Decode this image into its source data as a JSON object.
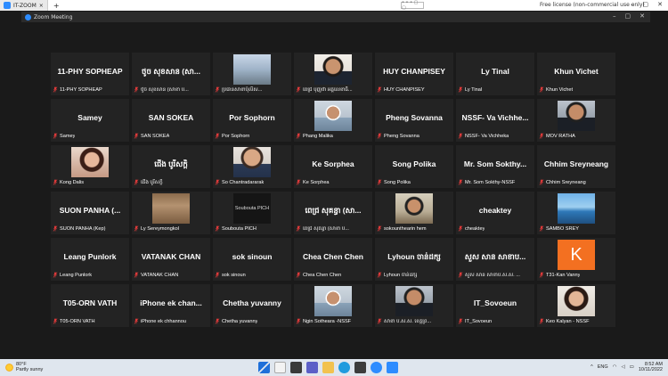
{
  "browser": {
    "tab_title": "IT-ZOOM",
    "new_tab_label": "+",
    "license_text": "Free license (non-commercial use only)",
    "center_indicator": "• • • ▢ ▢"
  },
  "zoom": {
    "title": "Zoom Meeting"
  },
  "participants": [
    {
      "display": "11-PHY SOPHEAP",
      "name": "11-PHY SOPHEAP",
      "video": false
    },
    {
      "display": "ថូច សុខសាន (សា...",
      "name": "ថូច សុខសាន (សាខា ប...",
      "video": false
    },
    {
      "display": "",
      "name": "ប្រធានសាខាប៉ុលិស...",
      "video": true,
      "photo": "ph-room"
    },
    {
      "display": "",
      "name": "ពេជ្រ បុញថា អគ្គលេខាធិ...",
      "video": true,
      "photo": "ph-face2"
    },
    {
      "display": "HUY CHANPISEY",
      "name": "HUY CHANPISEY",
      "video": false
    },
    {
      "display": "Ly Tinal",
      "name": "Ly Tinal",
      "video": false
    },
    {
      "display": "Khun Vichet",
      "name": "Khun Vichet",
      "video": false
    },
    {
      "display": "Samey",
      "name": "Samey",
      "video": false
    },
    {
      "display": "SAN SOKEA",
      "name": "SAN SOKEA",
      "video": false
    },
    {
      "display": "Por Sophorn",
      "name": "Por Sophorn",
      "video": false
    },
    {
      "display": "",
      "name": "Phang Malika",
      "video": true,
      "photo": "ph-mask"
    },
    {
      "display": "Pheng Sovanna",
      "name": "Pheng Sovanna",
      "video": false
    },
    {
      "display": "NSSF- Va Vichhe...",
      "name": "NSSF- Va Vichheka",
      "video": false
    },
    {
      "display": "",
      "name": "MOV RATHA",
      "video": true,
      "photo": "ph-suit"
    },
    {
      "display": "",
      "name": "Kong Dalis",
      "video": true,
      "photo": "ph-girl"
    },
    {
      "display": "ជើង បូរីសក្តិ",
      "name": "ជើង បូរីសក្តិ",
      "video": false
    },
    {
      "display": "",
      "name": "So Chantradararak",
      "video": true,
      "photo": "ph-face"
    },
    {
      "display": "Ke Sorphea",
      "name": "Ke Sorphea",
      "video": false
    },
    {
      "display": "Song Polika",
      "name": "Song Polika",
      "video": false
    },
    {
      "display": "Mr. Som Sokthy...",
      "name": "Mr. Som Sokthy-NSSF",
      "video": false
    },
    {
      "display": "Chhim Sreyneang",
      "name": "Chhim Sreyneang",
      "video": false
    },
    {
      "display": "SUON PANHA (...",
      "name": "SUON PANHA (Kep)",
      "video": false
    },
    {
      "display": "",
      "name": "Ly Sereymongkol",
      "video": true,
      "photo": "ph-arch"
    },
    {
      "display": "",
      "name": "Soubouta PICH",
      "video": true,
      "photo": "ph-dark",
      "overlay": "Soubouta PICH"
    },
    {
      "display": "ពេជ្រ សុគន្ធា (សា...",
      "name": "ពេជ្រ សុគន្ធា (សាខា ប...",
      "video": false
    },
    {
      "display": "",
      "name": "sokounthearin hem",
      "video": true,
      "photo": "ph-office"
    },
    {
      "display": "cheaktey",
      "name": "cheaktey",
      "video": false
    },
    {
      "display": "",
      "name": "SAMBO SREY",
      "video": true,
      "photo": "ph-beach"
    },
    {
      "display": "Leang Punlork",
      "name": "Leang Punlork",
      "video": false
    },
    {
      "display": "VATANAK CHAN",
      "name": "VATANAK CHAN",
      "video": false
    },
    {
      "display": "sok sinoun",
      "name": "sok sinoun",
      "video": false
    },
    {
      "display": "Chea Chen Chen",
      "name": "Chea Chen Chen",
      "video": false
    },
    {
      "display": "Lyhoun ចាន់ដក្ស",
      "name": "Lyhoun ចាន់ដក្ស",
      "video": false
    },
    {
      "display": "សួស សាន សាខាប...",
      "name": "សួស សាន សាខាប.ស.ស. ...",
      "video": false
    },
    {
      "display": "",
      "name": "T31-Kan Vanny",
      "video": true,
      "photo": "ph-orange",
      "letter": "K"
    },
    {
      "display": "T05-ORN VATH",
      "name": "T05-ORN VATH",
      "video": false
    },
    {
      "display": "iPhone ek chan...",
      "name": "iPhone ek chhannou",
      "video": false
    },
    {
      "display": "Chetha yuvanny",
      "name": "Chetha yuvanny",
      "video": false
    },
    {
      "display": "",
      "name": "Ngin Sotheara -NSSF",
      "video": true,
      "photo": "ph-mask"
    },
    {
      "display": "",
      "name": "សាខា ប.ស.ស. ខេត្តព្រ...",
      "video": true,
      "photo": "ph-suit"
    },
    {
      "display": "IT_Sovoeun",
      "name": "IT_Sovoeun",
      "video": false
    },
    {
      "display": "",
      "name": "Keo Kalyan - NSSF",
      "video": true,
      "photo": "ph-woman2"
    }
  ],
  "taskbar": {
    "temp": "80°F",
    "weather": "Partly sunny",
    "lang": "ENG",
    "time": "8:52 AM",
    "date": "10/11/2022"
  }
}
